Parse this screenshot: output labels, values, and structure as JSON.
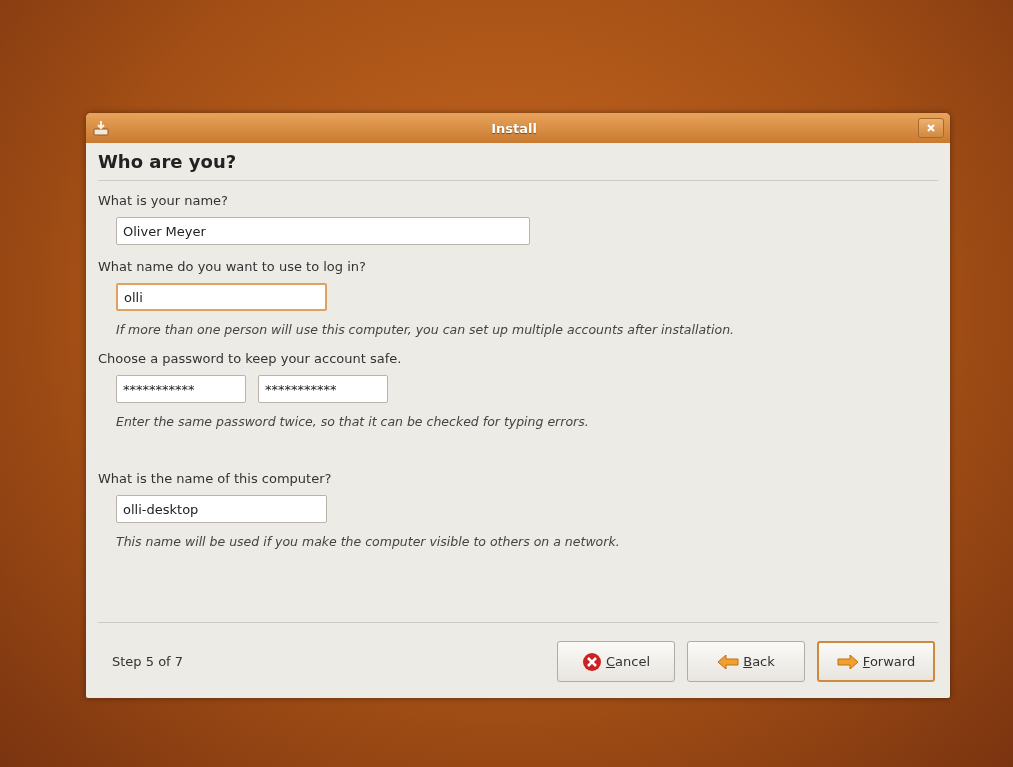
{
  "window": {
    "title": "Install"
  },
  "heading": "Who are you?",
  "sections": [
    {
      "label": "What is your name?",
      "fields": [
        {
          "value": "Oliver Meyer",
          "focused": false
        }
      ]
    },
    {
      "label": "What name do you want to use to log in?",
      "fields": [
        {
          "value": "olli",
          "focused": true
        }
      ],
      "hint": "If more than one person will use this computer, you can set up multiple accounts after installation."
    },
    {
      "label": "Choose a password to keep your account safe.",
      "fields": [
        {
          "value": "***********",
          "focused": false
        },
        {
          "value": "***********",
          "focused": false
        }
      ],
      "hint": "Enter the same password twice, so that it can be checked for typing errors."
    },
    {
      "label": "What is the name of this computer?",
      "fields": [
        {
          "value": "olli-desktop",
          "focused": false
        }
      ],
      "hint": "This name will be used if you make the computer visible to others on a network."
    }
  ],
  "footer": {
    "step": "Step 5 of 7",
    "buttons": [
      {
        "label": "Cancel",
        "kind": "cancel",
        "default": false
      },
      {
        "label": "Back",
        "kind": "back",
        "default": false
      },
      {
        "label": "Forward",
        "kind": "forward",
        "default": true
      }
    ]
  }
}
